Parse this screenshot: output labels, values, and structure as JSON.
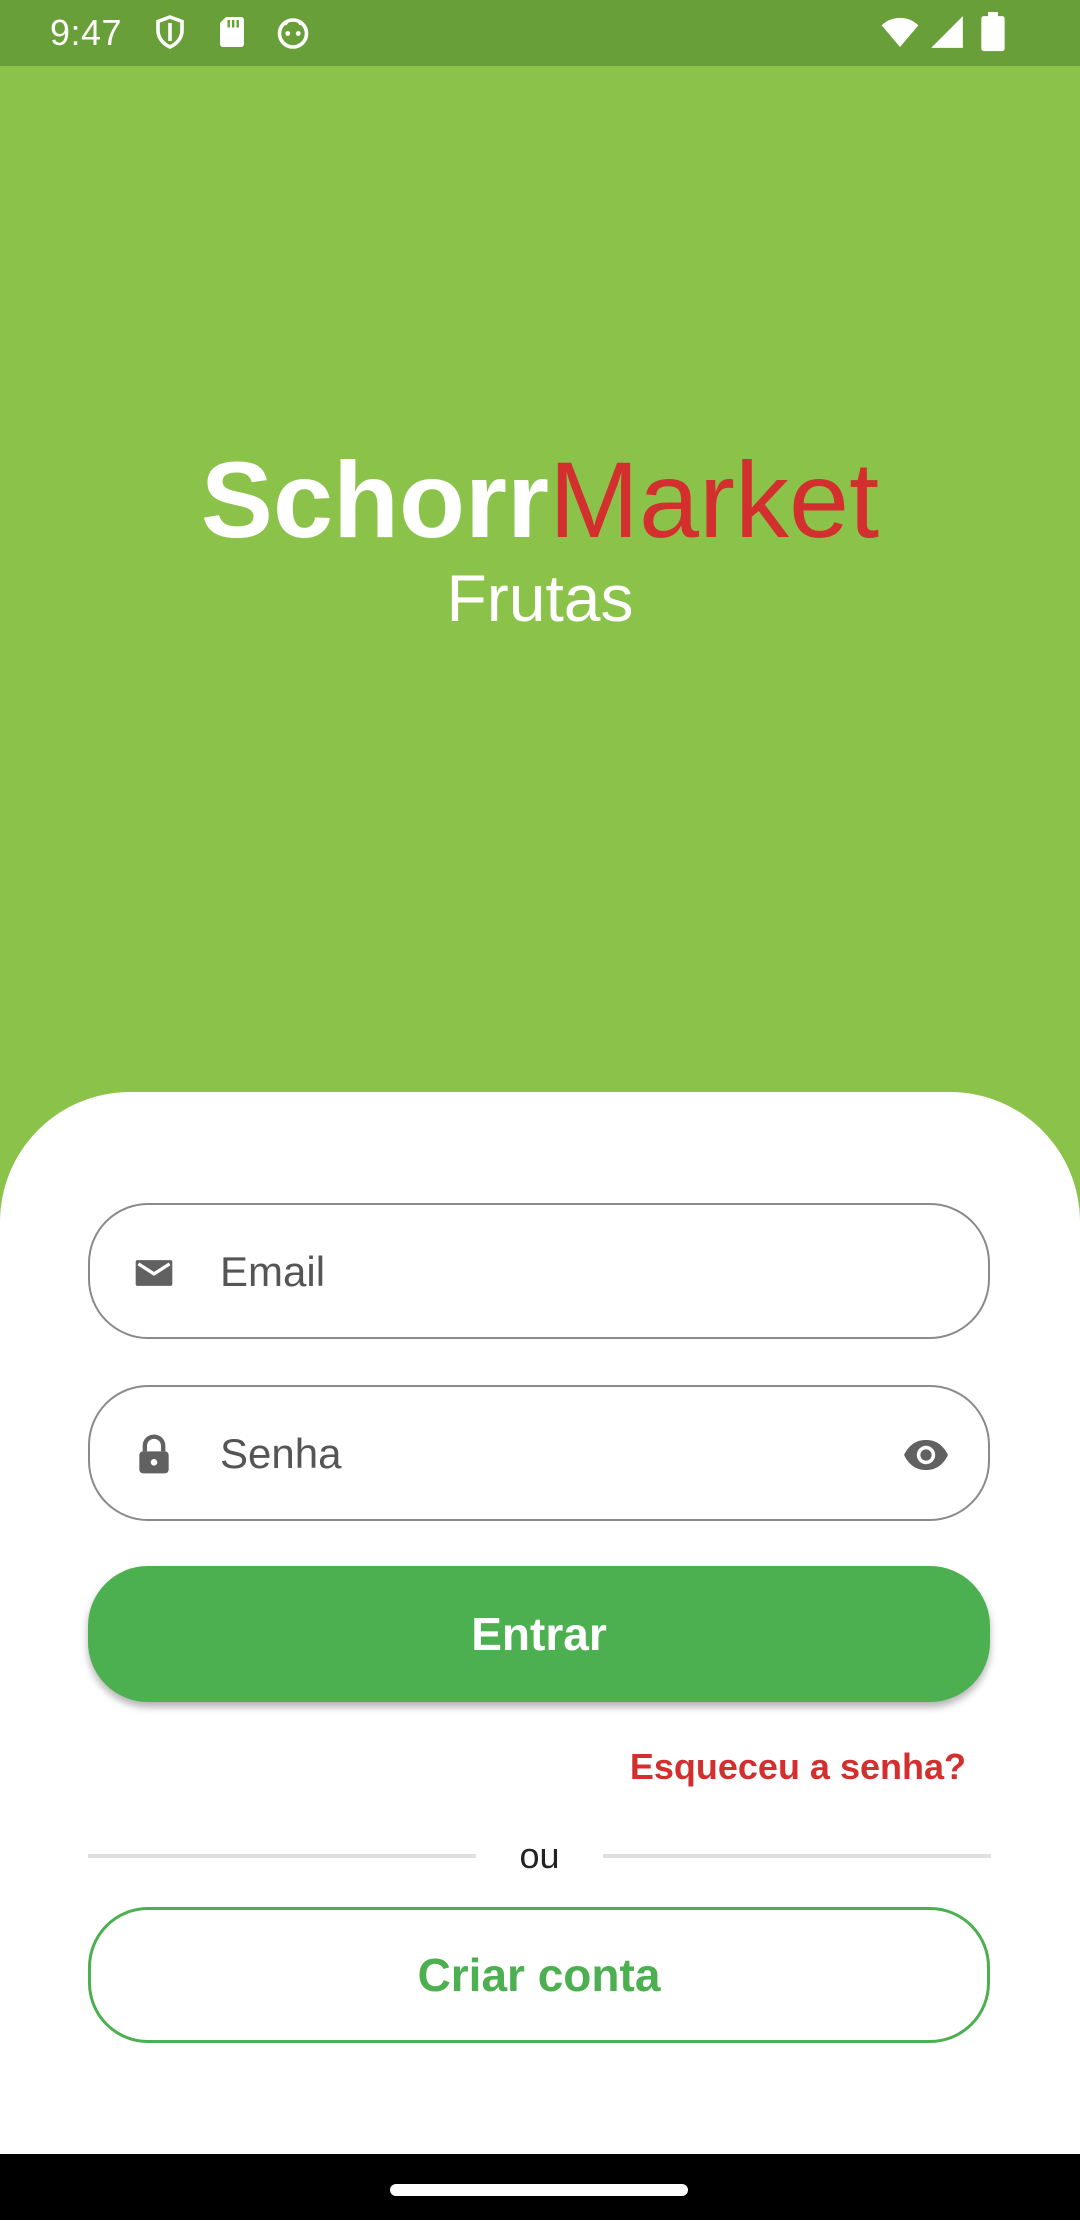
{
  "status_bar": {
    "time": "9:47",
    "icons": [
      "shield-icon",
      "sd-card-icon",
      "android-head-icon",
      "wifi-icon",
      "signal-icon",
      "battery-icon"
    ]
  },
  "brand": {
    "title_part1": "Schorr",
    "title_part2": "Market",
    "subtitle": "Frutas"
  },
  "login_form": {
    "email_placeholder": "Email",
    "password_placeholder": "Senha",
    "submit_label": "Entrar",
    "forgot_label": "Esqueceu a senha?",
    "divider_label": "ou",
    "signup_label": "Criar conta"
  },
  "colors": {
    "header_background": "#8bc34a",
    "status_bar": "#689f38",
    "primary_green": "#4caf50",
    "accent_red": "#d32f2f"
  }
}
